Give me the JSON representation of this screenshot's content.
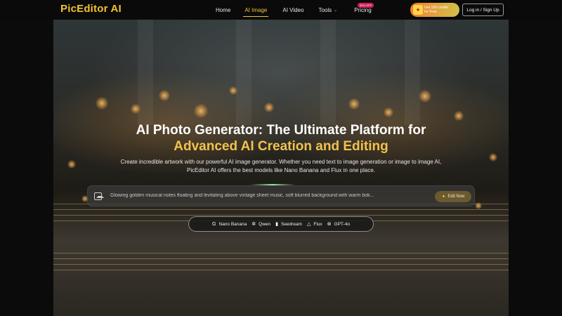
{
  "brand": {
    "logo": "PicEditor AI"
  },
  "nav": {
    "items": [
      {
        "label": "Home",
        "active": false
      },
      {
        "label": "AI Image",
        "active": true
      },
      {
        "label": "AI Video",
        "active": false
      },
      {
        "label": "Tools",
        "active": false
      },
      {
        "label": "Pricing",
        "active": false
      }
    ],
    "pricing_badge": "30% OFF",
    "tools_chevron": "⌄"
  },
  "promo": {
    "line1": "Get 100 credits",
    "line2": "for Free"
  },
  "auth": {
    "login_label": "Log in / Sign Up"
  },
  "hero": {
    "title_line1": "AI Photo Generator: The Ultimate Platform for",
    "title_line2": "Advanced AI Creation and Editing",
    "subtitle_line1": "Create incredible artwork with our powerful AI image generator. Whether you need text to image generation or image to image AI,",
    "subtitle_line2": "PicEditor AI offers the best models like Nano Banana and Flux in one place."
  },
  "prompt": {
    "placeholder": "Glowing golden musical notes floating and levitating above vintage sheet music, soft blurred background with warm bok...",
    "edit_label": "Edit Now"
  },
  "models": [
    {
      "label": "Nano Banana",
      "icon": "google-icon"
    },
    {
      "label": "Qwen",
      "icon": "qwen-icon"
    },
    {
      "label": "Seedream",
      "icon": "seedream-icon"
    },
    {
      "label": "Flux",
      "icon": "flux-icon"
    },
    {
      "label": "GPT-4o",
      "icon": "openai-icon"
    }
  ],
  "colors": {
    "accent": "#f1c232",
    "background": "#0a0a0a"
  }
}
